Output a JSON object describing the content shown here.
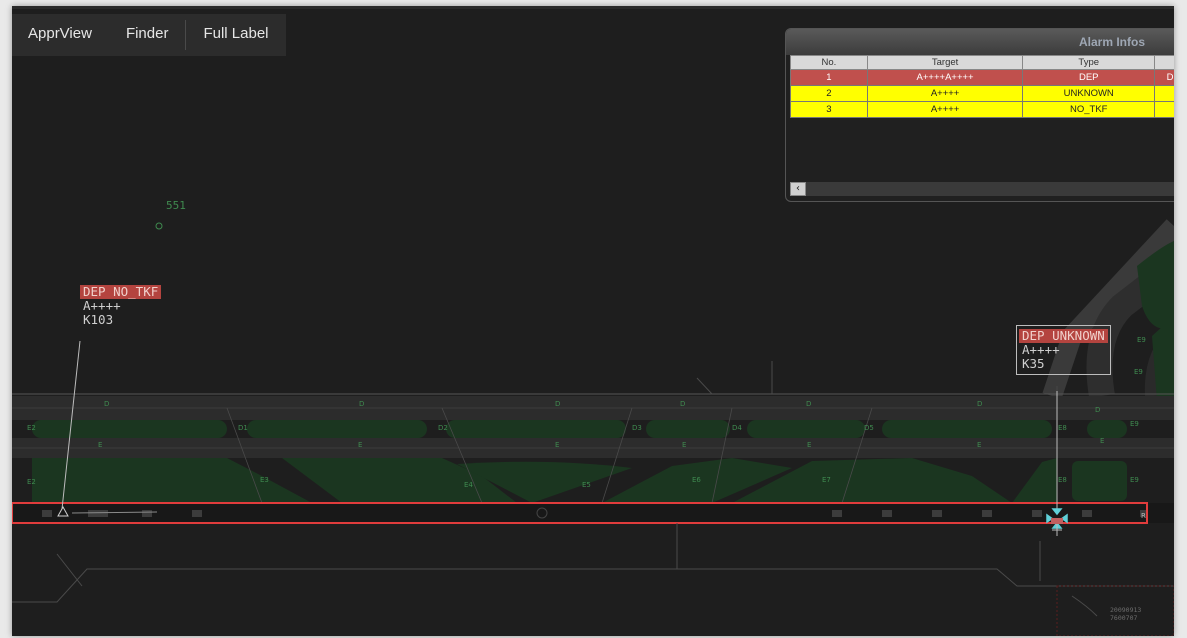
{
  "toolbar": {
    "items": [
      {
        "label": "ApprView"
      },
      {
        "label": "Finder"
      },
      {
        "label": "Full Label"
      }
    ]
  },
  "alarm_panel": {
    "title": "Alarm Infos",
    "columns": [
      "No.",
      "Target",
      "Type",
      ""
    ],
    "rows": [
      {
        "no": "1",
        "target": "A++++A++++",
        "type": "DEP",
        "extra": "D",
        "status_color": "#c0504d"
      },
      {
        "no": "2",
        "target": "A++++",
        "type": "UNKNOWN",
        "extra": "",
        "status_color": "#ffff00"
      },
      {
        "no": "3",
        "target": "A++++",
        "type": "NO_TKF",
        "extra": "",
        "status_color": "#ffff00"
      }
    ],
    "scroll_icon": "chevron-left-icon"
  },
  "targets": [
    {
      "alarm": "DEP NO_TKF",
      "callsign": "A++++",
      "stand": "K103"
    },
    {
      "alarm": "DEP UNKNOWN",
      "callsign": "A++++",
      "stand": "K35"
    }
  ],
  "beacon": {
    "id": "551"
  },
  "taxiway_labels": {
    "d_row": [
      "D",
      "D",
      "D",
      "D",
      "D",
      "D"
    ],
    "segment": [
      "E2",
      "D1",
      "D2",
      "D3",
      "D4",
      "D5",
      "E8",
      "E9"
    ],
    "e_row": [
      "E",
      "E",
      "E",
      "E",
      "E",
      "E",
      "E"
    ],
    "lower": [
      "E2",
      "E3",
      "E4",
      "E5",
      "E6",
      "E7",
      "E8",
      "E9"
    ],
    "right": [
      "E9",
      "E9",
      "D"
    ],
    "runway_end": "R"
  },
  "corner_text": [
    "20090913",
    "7600707"
  ],
  "colors": {
    "runway_alert": "#e03c3c",
    "label_alarm": "#b4443f",
    "grass": "#1b3620",
    "taxiway": "#2e2e2e"
  }
}
